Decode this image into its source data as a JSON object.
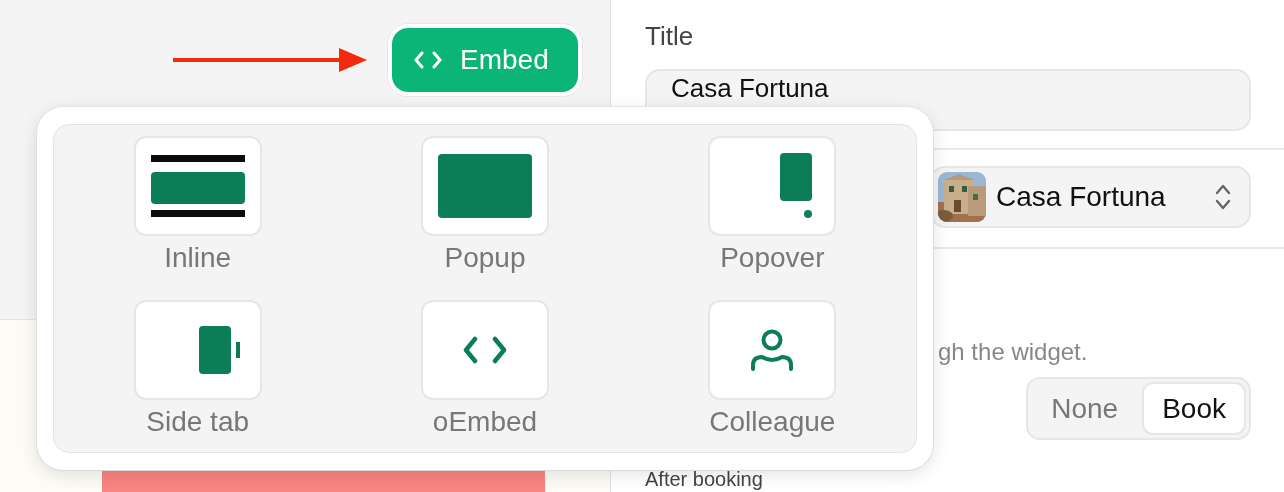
{
  "embed_button": {
    "label": "Embed"
  },
  "embed_menu": {
    "options": [
      {
        "kind": "inline",
        "label": "Inline"
      },
      {
        "kind": "popup",
        "label": "Popup"
      },
      {
        "kind": "popover",
        "label": "Popover"
      },
      {
        "kind": "sidetab",
        "label": "Side tab"
      },
      {
        "kind": "oembed",
        "label": "oEmbed"
      },
      {
        "kind": "colleague",
        "label": "Colleague"
      }
    ]
  },
  "title_field": {
    "label": "Title",
    "value": "Casa Fortuna"
  },
  "venue_select": {
    "value": "Casa Fortuna"
  },
  "description": {
    "text": "gh the widget."
  },
  "action_toggle": {
    "options": [
      {
        "label": "None",
        "selected": false
      },
      {
        "label": "Book",
        "selected": true
      }
    ]
  },
  "after_booking": {
    "label": "After booking"
  }
}
